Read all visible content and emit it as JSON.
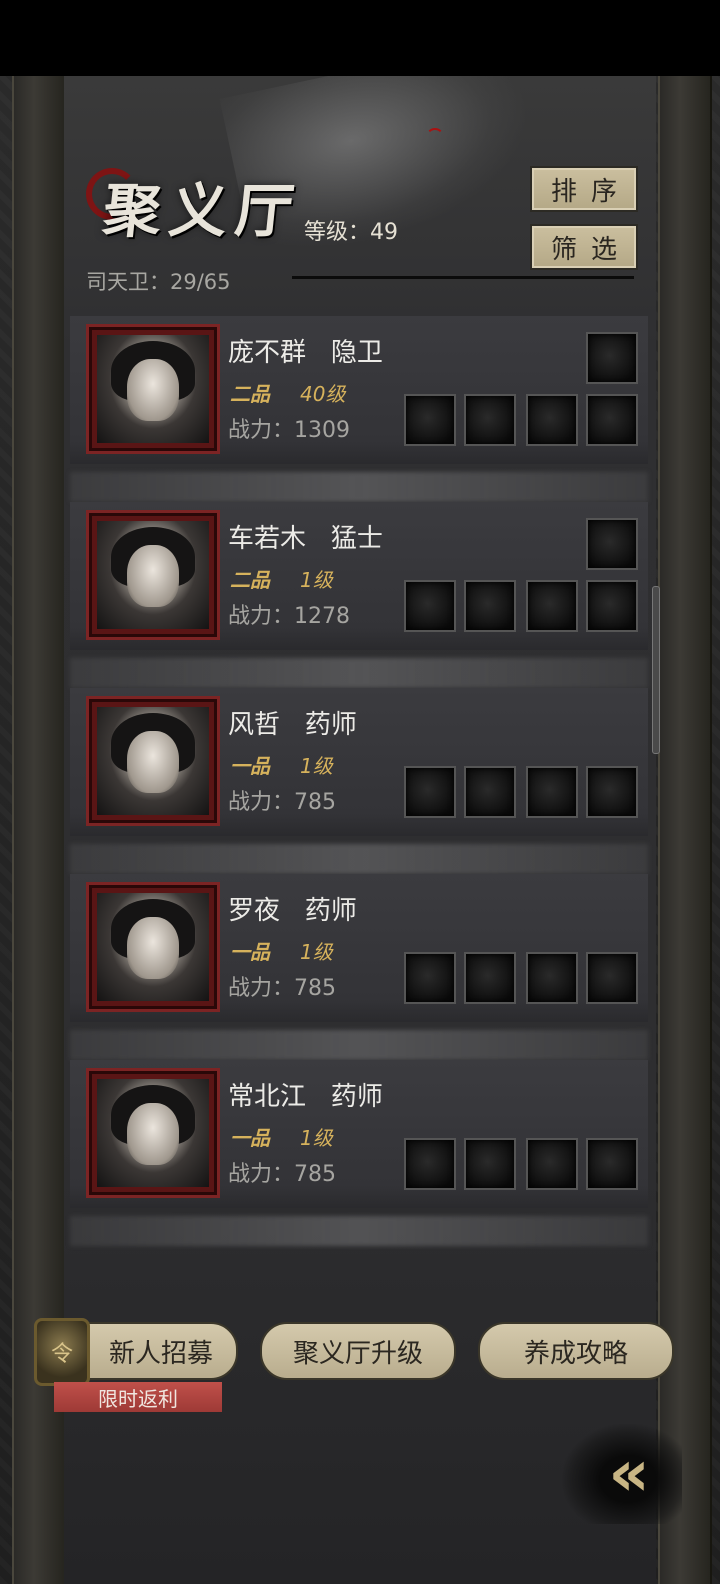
{
  "header": {
    "title": "聚义厅",
    "level_text": "等级：49",
    "count_text": "司天卫：29/65",
    "sort_label": "排序",
    "filter_label": "筛选"
  },
  "members": [
    {
      "name": "庞不群",
      "role": "隐卫",
      "grade": "二品",
      "level": "40级",
      "power": "战力：1309",
      "extra_slot": true
    },
    {
      "name": "车若木",
      "role": "猛士",
      "grade": "二品",
      "level": "1级",
      "power": "战力：1278",
      "extra_slot": true
    },
    {
      "name": "风哲",
      "role": "药师",
      "grade": "一品",
      "level": "1级",
      "power": "战力：785",
      "extra_slot": false
    },
    {
      "name": "罗夜",
      "role": "药师",
      "grade": "一品",
      "level": "1级",
      "power": "战力：785",
      "extra_slot": false
    },
    {
      "name": "常北江",
      "role": "药师",
      "grade": "一品",
      "level": "1级",
      "power": "战力：785",
      "extra_slot": false
    }
  ],
  "footer": {
    "recruit_label": "新人招募",
    "recruit_badge": "限时返利",
    "upgrade_label": "聚义厅升级",
    "guide_label": "养成攻略",
    "back_glyph": "«"
  }
}
